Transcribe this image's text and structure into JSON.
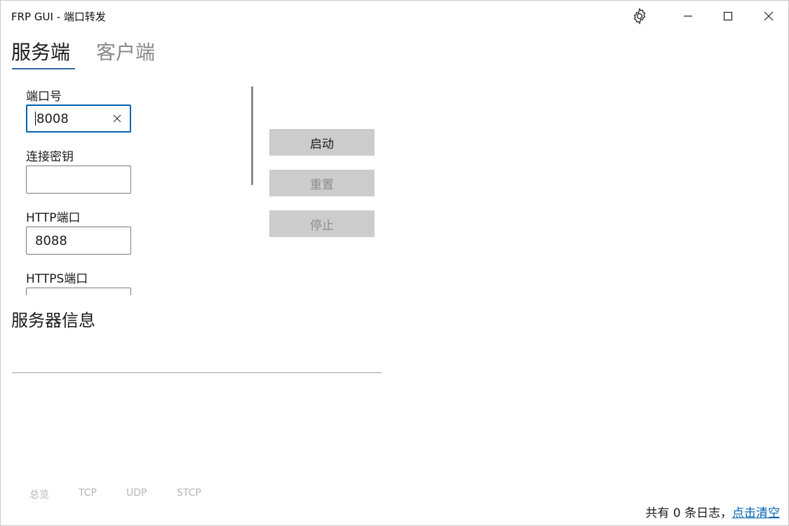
{
  "window": {
    "title": "FRP GUI - 端口转发",
    "accent_color": "#0063b1"
  },
  "tabs": [
    {
      "label": "服务端",
      "selected": true
    },
    {
      "label": "客户端",
      "selected": false
    }
  ],
  "form": {
    "port_label": "端口号",
    "port_value": "8008",
    "secret_label": "连接密钥",
    "secret_value": "",
    "http_port_label": "HTTP端口",
    "http_port_value": "8088",
    "https_port_label": "HTTPS端口",
    "https_port_value": ""
  },
  "actions": {
    "start": "启动",
    "reset": "重置",
    "stop": "停止"
  },
  "server_info": {
    "title": "服务器信息"
  },
  "bottom_tabs": [
    "总览",
    "TCP",
    "UDP",
    "STCP"
  ],
  "log": {
    "prefix": "共有 0 条日志，",
    "clear_link": "点击清空"
  },
  "icons": {
    "settings": "gear-icon",
    "minimize": "minimize-icon",
    "maximize": "maximize-icon",
    "close": "close-icon",
    "clear": "clear-x-icon"
  }
}
